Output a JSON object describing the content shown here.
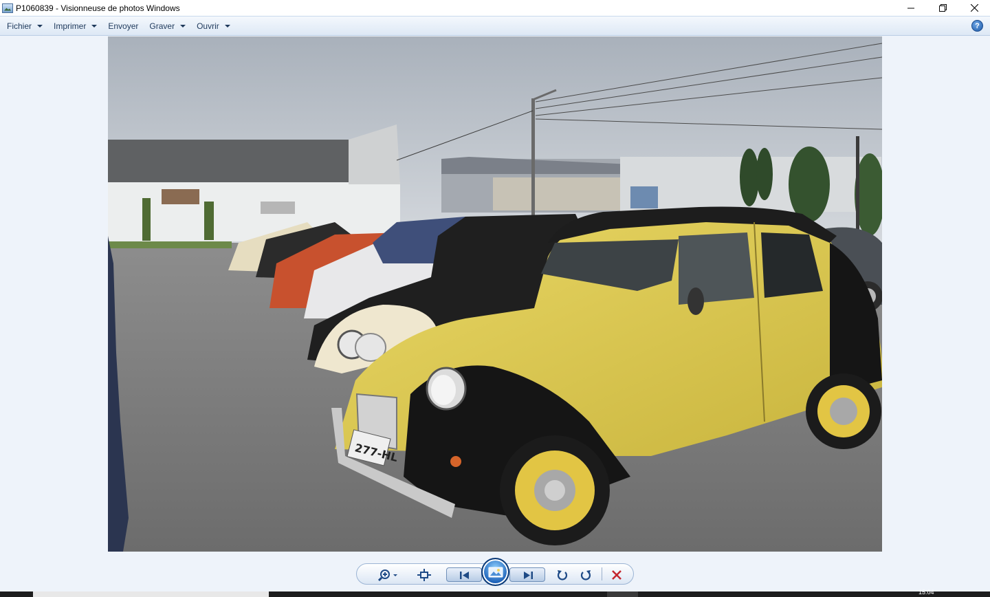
{
  "window": {
    "title": "P1060839 - Visionneuse de photos Windows",
    "controls": [
      "minimize",
      "restore",
      "close"
    ]
  },
  "menu": {
    "items": [
      {
        "label": "Fichier",
        "has_dropdown": true
      },
      {
        "label": "Imprimer",
        "has_dropdown": true
      },
      {
        "label": "Envoyer",
        "has_dropdown": false
      },
      {
        "label": "Graver",
        "has_dropdown": true
      },
      {
        "label": "Ouvrir",
        "has_dropdown": true
      }
    ],
    "help_label": "?"
  },
  "photo": {
    "subject": "row of Citroën 2CV cars in a parking lot, yellow and black car in front",
    "plate_text": "277-HL"
  },
  "controls": {
    "icons": [
      "zoom-icon",
      "fit-window-icon",
      "previous-icon",
      "slideshow-icon",
      "next-icon",
      "rotate-left-icon",
      "rotate-right-icon",
      "delete-icon"
    ]
  },
  "taskbar": {
    "clock_partial": "15:04"
  },
  "colors": {
    "menu_text": "#1e395b",
    "background": "#eef3fa",
    "delete_red": "#c4262e",
    "accent_blue": "#1a5fb7"
  }
}
